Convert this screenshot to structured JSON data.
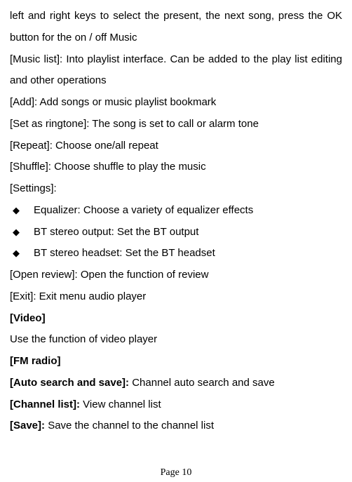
{
  "intro1": "left and right keys to select the present, the next song, press the OK button for the on / off Music",
  "music_list": "[Music list]: Into playlist interface. Can be added to the play list editing and other operations",
  "add": "[Add]: Add songs or music playlist bookmark",
  "ringtone": "[Set as ringtone]: The song is set to call or alarm tone",
  "repeat": "[Repeat]: Choose one/all repeat",
  "shuffle": "[Shuffle]: Choose shuffle to play the music",
  "settings": "[Settings]:",
  "bullets": {
    "eq": "Equalizer: Choose a variety of equalizer effects",
    "bt_output": "BT stereo output: Set the BT output",
    "bt_headset": "BT stereo headset: Set the BT headset"
  },
  "open_review": "[Open review]: Open the function of review",
  "exit": "[Exit]: Exit menu audio player",
  "video_h": "[Video]",
  "video_t": "Use the function of video player",
  "fm_h": "[FM radio]",
  "auto_l": "[Auto search and save]: ",
  "auto_t": "Channel auto search and save",
  "chan_l": "[Channel list]: ",
  "chan_t": "View channel list",
  "save_l": "[Save]: ",
  "save_t": "Save the channel to the channel list",
  "page": "Page 10",
  "diamond": "◆"
}
